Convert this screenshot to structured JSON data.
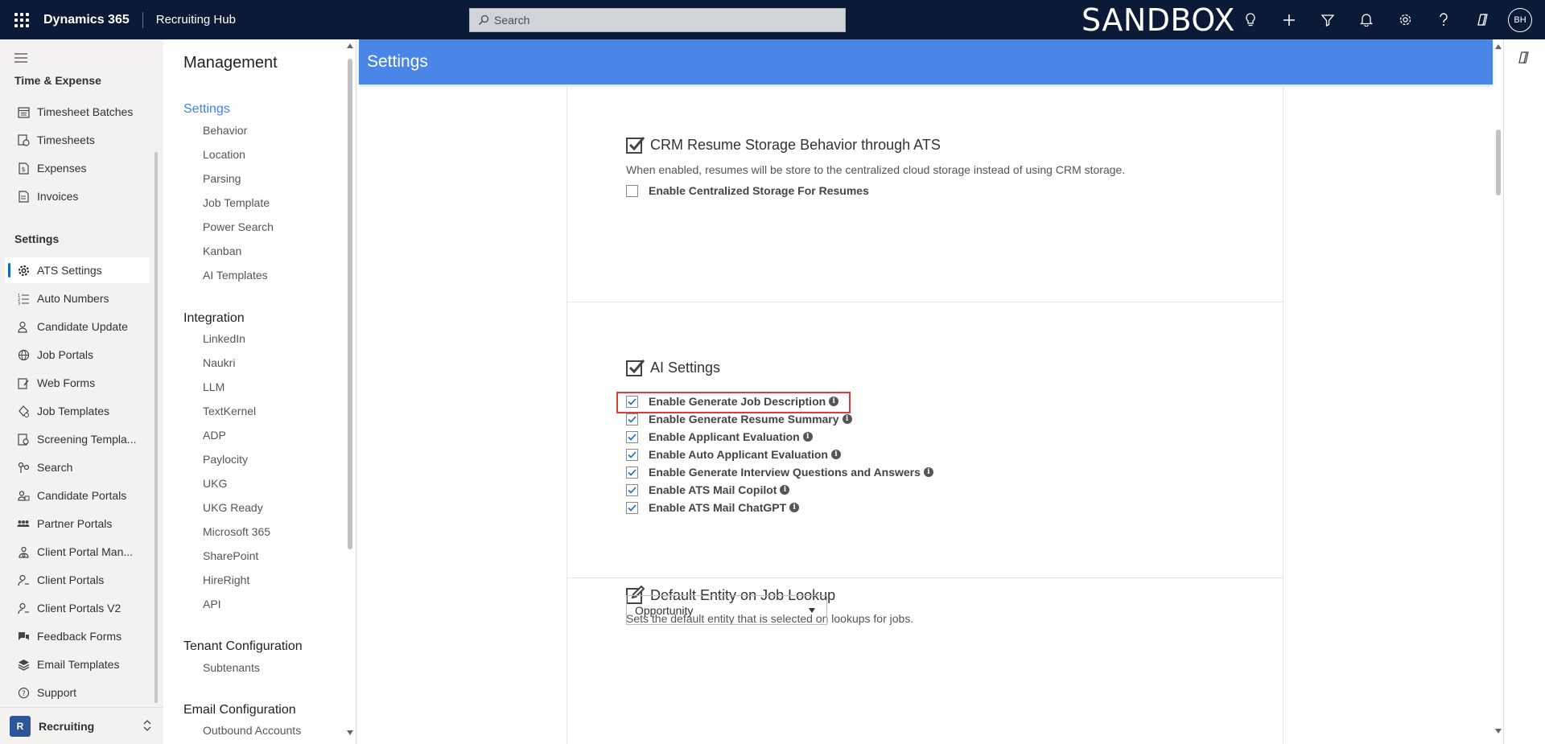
{
  "topbar": {
    "brand": "Dynamics 365",
    "app_name": "Recruiting Hub",
    "search_placeholder": "Search",
    "environment_label": "SANDBOX",
    "avatar_initials": "BH"
  },
  "leftnav": {
    "section_time": "Time & Expense",
    "time_items": [
      {
        "label": "Timesheet Batches",
        "icon": "calendar-icon"
      },
      {
        "label": "Timesheets",
        "icon": "timesheet-icon"
      },
      {
        "label": "Expenses",
        "icon": "expense-icon"
      },
      {
        "label": "Invoices",
        "icon": "invoice-icon"
      }
    ],
    "section_settings": "Settings",
    "settings_items": [
      {
        "label": "ATS Settings",
        "icon": "gear-icon",
        "active": true
      },
      {
        "label": "Auto Numbers",
        "icon": "numbered-list-icon"
      },
      {
        "label": "Candidate Update",
        "icon": "person-sync-icon"
      },
      {
        "label": "Job Portals",
        "icon": "globe-icon"
      },
      {
        "label": "Web Forms",
        "icon": "form-icon"
      },
      {
        "label": "Job Templates",
        "icon": "template-icon"
      },
      {
        "label": "Screening Templa...",
        "icon": "screening-icon"
      },
      {
        "label": "Search",
        "icon": "search-flow-icon"
      },
      {
        "label": "Candidate Portals",
        "icon": "people-icon"
      },
      {
        "label": "Partner Portals",
        "icon": "partner-icon"
      },
      {
        "label": "Client Portal Man...",
        "icon": "client-manage-icon"
      },
      {
        "label": "Client Portals",
        "icon": "person-icon"
      },
      {
        "label": "Client Portals V2",
        "icon": "person-icon"
      },
      {
        "label": "Feedback Forms",
        "icon": "feedback-icon"
      },
      {
        "label": "Email Templates",
        "icon": "layers-icon"
      },
      {
        "label": "Support",
        "icon": "help-circle-icon"
      }
    ],
    "area_badge": "R",
    "area_label": "Recruiting"
  },
  "management": {
    "title": "Management",
    "settings_group": "Settings",
    "settings_links": [
      "Behavior",
      "Location",
      "Parsing",
      "Job Template",
      "Power Search",
      "Kanban",
      "AI Templates"
    ],
    "integration_group": "Integration",
    "integration_links": [
      "LinkedIn",
      "Naukri",
      "LLM",
      "TextKernel",
      "ADP",
      "Paylocity",
      "UKG",
      "UKG Ready",
      "Microsoft 365",
      "SharePoint",
      "HireRight",
      "API"
    ],
    "tenant_group": "Tenant Configuration",
    "tenant_links": [
      "Subtenants"
    ],
    "email_group": "Email Configuration",
    "email_links": [
      "Outbound Accounts"
    ]
  },
  "content": {
    "header": "Settings",
    "crm_section": {
      "title": "CRM Resume Storage Behavior through ATS",
      "description": "When enabled, resumes will be store to the centralized cloud storage instead of using CRM storage.",
      "checkbox_label": "Enable Centralized Storage For Resumes",
      "checked": false
    },
    "ai_section": {
      "title": "AI Settings",
      "options": [
        {
          "label": "Enable Generate Job Description",
          "checked": true
        },
        {
          "label": "Enable Generate Resume Summary",
          "checked": true
        },
        {
          "label": "Enable Applicant Evaluation",
          "checked": true
        },
        {
          "label": "Enable Auto Applicant Evaluation",
          "checked": true
        },
        {
          "label": "Enable Generate Interview Questions and Answers",
          "checked": true
        },
        {
          "label": "Enable ATS Mail Copilot",
          "checked": true
        },
        {
          "label": "Enable ATS Mail ChatGPT",
          "checked": true
        }
      ]
    },
    "entity_section": {
      "title": "Default Entity on Job Lookup",
      "description": "Sets the default entity that is selected on lookups for jobs.",
      "selected_value": "Opportunity"
    }
  },
  "colors": {
    "topbar": "#0b1a36",
    "header_blue": "#4a86e8",
    "link_blue": "#3b82f6",
    "highlight_red": "#e03b3b",
    "check_blue": "#0f6cbd"
  }
}
